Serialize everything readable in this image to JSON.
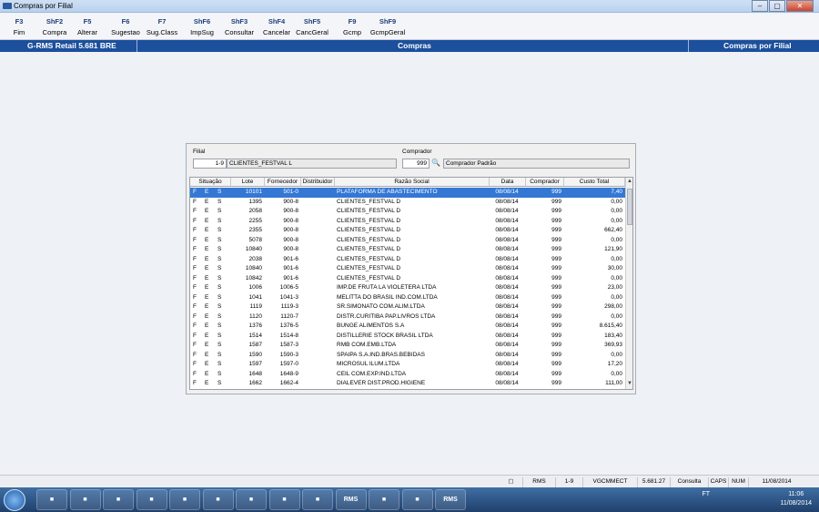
{
  "window": {
    "title": "Compras por Filial",
    "minimize": "–",
    "maximize": "▢",
    "close": "✕"
  },
  "fkeys": [
    {
      "key": "F3",
      "label": "Fim"
    },
    {
      "key": "ShF2",
      "label": "Compra"
    },
    {
      "key": "F5",
      "label": "Alterar"
    },
    {
      "key": "F6",
      "label": "Sugestao"
    },
    {
      "key": "F7",
      "label": "Sug.Class"
    },
    {
      "key": "ShF6",
      "label": "ImpSug"
    },
    {
      "key": "ShF3",
      "label": "Consultar"
    },
    {
      "key": "ShF4",
      "label": "Cancelar"
    },
    {
      "key": "ShF5",
      "label": "CancGeral"
    },
    {
      "key": "F9",
      "label": "Gcmp"
    },
    {
      "key": "ShF9",
      "label": "GcmpGeral"
    }
  ],
  "header": {
    "left": "G-RMS Retail 5.681 BRE",
    "center": "Compras",
    "right": "Compras por Filial"
  },
  "form": {
    "filial_label": "Filial",
    "filial_code": "1-9",
    "filial_name": "CLIENTES_FESTVAL L",
    "comprador_label": "Comprador",
    "comprador_code": "999",
    "comprador_name": "Comprador Padrão",
    "search_icon": "binoculars-icon"
  },
  "grid": {
    "columns": [
      "Situação",
      "Lote",
      "Fornecedor",
      "Distribuidor",
      "Razão Social",
      "Data",
      "Comprador",
      "Custo Total"
    ],
    "rows": [
      {
        "s1": "F",
        "s2": "E",
        "s3": "S",
        "lote": "10101",
        "forn": "501-0",
        "dist": "",
        "razao": "PLATAFORMA DE ABASTECIMENTO",
        "data": "08/08/14",
        "comp": "999",
        "custo": "7,40"
      },
      {
        "s1": "F",
        "s2": "E",
        "s3": "S",
        "lote": "1395",
        "forn": "900-8",
        "dist": "",
        "razao": "CLIENTES_FESTVAL D",
        "data": "08/08/14",
        "comp": "999",
        "custo": "0,00"
      },
      {
        "s1": "F",
        "s2": "E",
        "s3": "S",
        "lote": "2058",
        "forn": "900-8",
        "dist": "",
        "razao": "CLIENTES_FESTVAL D",
        "data": "08/08/14",
        "comp": "999",
        "custo": "0,00"
      },
      {
        "s1": "F",
        "s2": "E",
        "s3": "S",
        "lote": "2255",
        "forn": "900-8",
        "dist": "",
        "razao": "CLIENTES_FESTVAL D",
        "data": "08/08/14",
        "comp": "999",
        "custo": "0,00"
      },
      {
        "s1": "F",
        "s2": "E",
        "s3": "S",
        "lote": "2355",
        "forn": "900-8",
        "dist": "",
        "razao": "CLIENTES_FESTVAL D",
        "data": "08/08/14",
        "comp": "999",
        "custo": "662,40"
      },
      {
        "s1": "F",
        "s2": "E",
        "s3": "S",
        "lote": "5078",
        "forn": "900-8",
        "dist": "",
        "razao": "CLIENTES_FESTVAL D",
        "data": "08/08/14",
        "comp": "999",
        "custo": "0,00"
      },
      {
        "s1": "F",
        "s2": "E",
        "s3": "S",
        "lote": "10840",
        "forn": "900-8",
        "dist": "",
        "razao": "CLIENTES_FESTVAL D",
        "data": "08/08/14",
        "comp": "999",
        "custo": "121,90"
      },
      {
        "s1": "F",
        "s2": "E",
        "s3": "S",
        "lote": "2038",
        "forn": "901-6",
        "dist": "",
        "razao": "CLIENTES_FESTVAL D",
        "data": "08/08/14",
        "comp": "999",
        "custo": "0,00"
      },
      {
        "s1": "F",
        "s2": "E",
        "s3": "S",
        "lote": "10840",
        "forn": "901-6",
        "dist": "",
        "razao": "CLIENTES_FESTVAL D",
        "data": "08/08/14",
        "comp": "999",
        "custo": "30,00"
      },
      {
        "s1": "F",
        "s2": "E",
        "s3": "S",
        "lote": "10842",
        "forn": "901-6",
        "dist": "",
        "razao": "CLIENTES_FESTVAL D",
        "data": "08/08/14",
        "comp": "999",
        "custo": "0,00"
      },
      {
        "s1": "F",
        "s2": "E",
        "s3": "S",
        "lote": "1006",
        "forn": "1006-5",
        "dist": "",
        "razao": "IMP.DE FRUTA LA VIOLETERA LTDA",
        "data": "08/08/14",
        "comp": "999",
        "custo": "23,00"
      },
      {
        "s1": "F",
        "s2": "E",
        "s3": "S",
        "lote": "1041",
        "forn": "1041-3",
        "dist": "",
        "razao": "MELITTA DO BRASIL IND.COM.LTDA",
        "data": "08/08/14",
        "comp": "999",
        "custo": "0,00"
      },
      {
        "s1": "F",
        "s2": "E",
        "s3": "S",
        "lote": "1119",
        "forn": "1119-3",
        "dist": "",
        "razao": "SR.SIMONATO COM.ALIM.LTDA",
        "data": "08/08/14",
        "comp": "999",
        "custo": "298,00"
      },
      {
        "s1": "F",
        "s2": "E",
        "s3": "S",
        "lote": "1120",
        "forn": "1120-7",
        "dist": "",
        "razao": "DISTR.CURITIBA PAP.LIVROS LTDA",
        "data": "08/08/14",
        "comp": "999",
        "custo": "0,00"
      },
      {
        "s1": "F",
        "s2": "E",
        "s3": "S",
        "lote": "1376",
        "forn": "1376-5",
        "dist": "",
        "razao": "BUNGE ALIMENTOS S.A",
        "data": "08/08/14",
        "comp": "999",
        "custo": "8.615,40"
      },
      {
        "s1": "F",
        "s2": "E",
        "s3": "S",
        "lote": "1514",
        "forn": "1514-8",
        "dist": "",
        "razao": "DISTILLERIE STOCK  BRASIL LTDA",
        "data": "08/08/14",
        "comp": "999",
        "custo": "183,40"
      },
      {
        "s1": "F",
        "s2": "E",
        "s3": "S",
        "lote": "1587",
        "forn": "1587-3",
        "dist": "",
        "razao": "RMB COM.EMB.LTDA",
        "data": "08/08/14",
        "comp": "999",
        "custo": "369,93"
      },
      {
        "s1": "F",
        "s2": "E",
        "s3": "S",
        "lote": "1590",
        "forn": "1590-3",
        "dist": "",
        "razao": "SPAIPA S.A.IND.BRAS.BEBIDAS",
        "data": "08/08/14",
        "comp": "999",
        "custo": "0,00"
      },
      {
        "s1": "F",
        "s2": "E",
        "s3": "S",
        "lote": "1597",
        "forn": "1597-0",
        "dist": "",
        "razao": "MICROSUL ILUM.LTDA",
        "data": "08/08/14",
        "comp": "999",
        "custo": "17,20"
      },
      {
        "s1": "F",
        "s2": "E",
        "s3": "S",
        "lote": "1648",
        "forn": "1648-9",
        "dist": "",
        "razao": "CEIL COM.EXP.IND.LTDA",
        "data": "08/08/14",
        "comp": "999",
        "custo": "0,00"
      },
      {
        "s1": "F",
        "s2": "E",
        "s3": "S",
        "lote": "1662",
        "forn": "1662-4",
        "dist": "",
        "razao": "DIALEVER DIST.PROD.HIGIENE",
        "data": "08/08/14",
        "comp": "999",
        "custo": "111,00"
      }
    ]
  },
  "statusbar": [
    "RMS",
    "1-9",
    "VGCMMECT",
    "5.681.27",
    "Consulta",
    "CAPS",
    "NUM",
    "11/08/2014"
  ],
  "taskbar": {
    "items": [
      "ie-icon",
      "explorer-icon",
      "media-icon",
      "outlook-icon",
      "lync-icon",
      "app-icon",
      "word-icon",
      "app2-icon",
      "app3-icon",
      "RMS",
      "pdf-icon",
      "app4-icon",
      "RMS"
    ],
    "tray_label": "FT",
    "time": "11:06",
    "date": "11/08/2014"
  }
}
